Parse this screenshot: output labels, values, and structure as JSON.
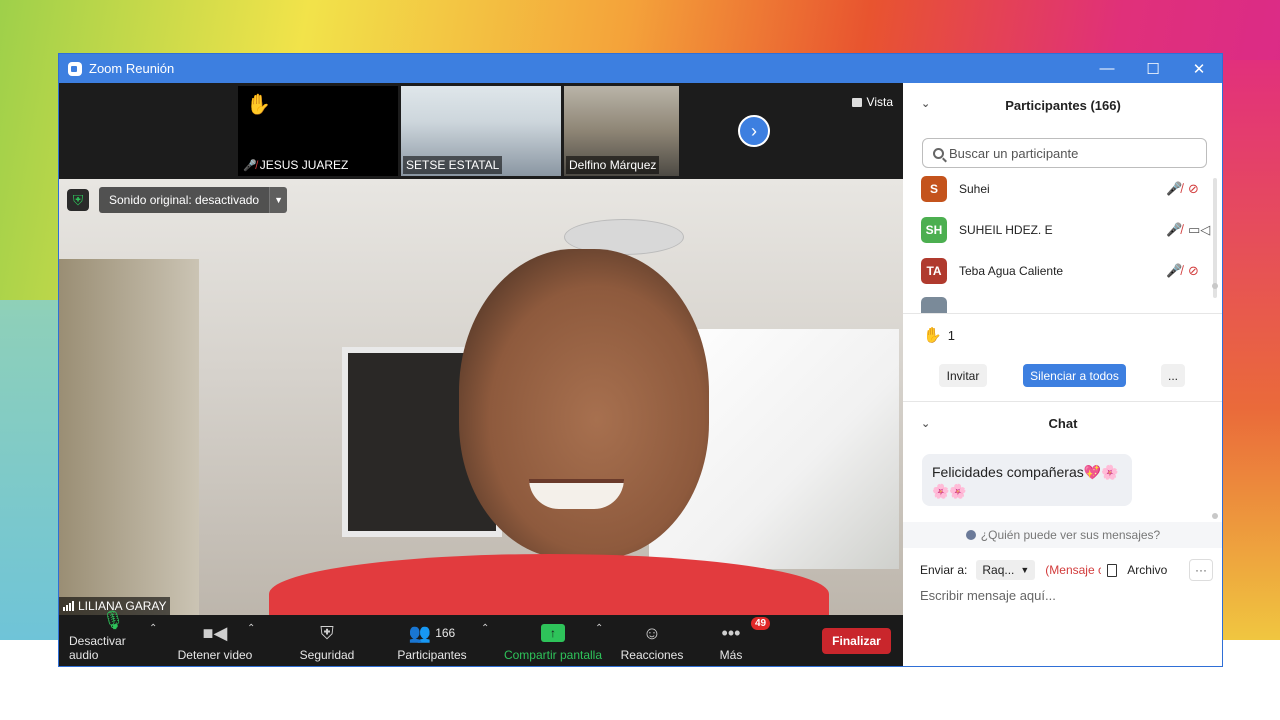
{
  "window": {
    "title": "Zoom Reunión"
  },
  "strip": {
    "thumbs": [
      {
        "name": "JESUS JUAREZ",
        "muted": true,
        "hand_raised": true
      },
      {
        "name": "SETSE ESTATAL"
      },
      {
        "name": "Delfino Márquez"
      }
    ],
    "vista_label": "Vista"
  },
  "main_video": {
    "sonido_label": "Sonido original: desactivado",
    "speaker_name": "LILIANA GARAY"
  },
  "toolbar": {
    "audio_label": "Desactivar audio",
    "video_label": "Detener video",
    "security_label": "Seguridad",
    "participants_label": "Participantes",
    "participants_count": "166",
    "share_label": "Compartir pantalla",
    "reactions_label": "Reacciones",
    "more_label": "Más",
    "more_badge": "49",
    "end_label": "Finalizar"
  },
  "participants_panel": {
    "title": "Participantes (166)",
    "search_placeholder": "Buscar un participante",
    "items": [
      {
        "initials": "S",
        "name": "Suhei",
        "color": "#c4531c",
        "cam": "off"
      },
      {
        "initials": "SH",
        "name": "SUHEIL HDEZ. E",
        "color": "#4caf50",
        "cam": "on"
      },
      {
        "initials": "TA",
        "name": "Teba Agua Caliente",
        "color": "#b03a2e",
        "cam": "off"
      }
    ],
    "raised_count": "1",
    "invite_label": "Invitar",
    "mute_all_label": "Silenciar a todos",
    "more_label": "..."
  },
  "chat": {
    "title": "Chat",
    "message": "Felicidades compañeras💖🌸🌸🌸",
    "who_can_see": "¿Quién puede ver sus mensajes?",
    "send_to_label": "Enviar a:",
    "recipient": "Raq...",
    "private_label": "(Mensaje c",
    "file_label": "Archivo",
    "input_placeholder": "Escribir mensaje aquí..."
  },
  "colors": {
    "titlebar": "#3d7fe0",
    "share_green": "#2ec35a",
    "end_red": "#c9262c",
    "mute_blue": "#3d7fe0"
  }
}
